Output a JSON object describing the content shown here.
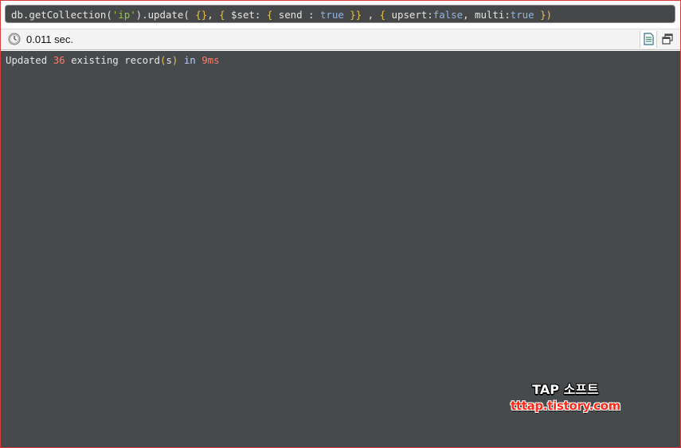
{
  "query": {
    "tokens": [
      {
        "text": "db.getCollection(",
        "type": "plain"
      },
      {
        "text": "'ip'",
        "type": "str"
      },
      {
        "text": ").update( ",
        "type": "plain"
      },
      {
        "text": "{}",
        "type": "brace"
      },
      {
        "text": ", ",
        "type": "plain"
      },
      {
        "text": "{",
        "type": "brace"
      },
      {
        "text": " $set: ",
        "type": "key"
      },
      {
        "text": "{",
        "type": "brace"
      },
      {
        "text": " send : ",
        "type": "key"
      },
      {
        "text": "true",
        "type": "bool"
      },
      {
        "text": " ",
        "type": "plain"
      },
      {
        "text": "}}",
        "type": "brace"
      },
      {
        "text": " , ",
        "type": "plain"
      },
      {
        "text": "{",
        "type": "brace"
      },
      {
        "text": " upsert:",
        "type": "key"
      },
      {
        "text": "false",
        "type": "bool"
      },
      {
        "text": ", multi:",
        "type": "key"
      },
      {
        "text": "true",
        "type": "bool"
      },
      {
        "text": " ",
        "type": "plain"
      },
      {
        "text": "})",
        "type": "brace"
      }
    ]
  },
  "status": {
    "elapsed": "0.011 sec.",
    "icons": {
      "clock": "clock-icon",
      "text_view": "document-icon",
      "popout": "popout-icon"
    }
  },
  "result": {
    "prefix": "Updated ",
    "count": "36",
    "middle": " existing record",
    "paren_open": "(",
    "suffix_letter": "s",
    "paren_close": ")",
    "in_word": " in ",
    "time": "9ms"
  },
  "watermark": {
    "title": "TAP 소프트",
    "url": "tttap.tistory.com"
  },
  "colors": {
    "query_bg": "#454748",
    "results_bg": "#474a4c",
    "number": "#ff7a6b",
    "string": "#96c93d",
    "boolean": "#8fb6e6",
    "brace": "#e8c34a"
  }
}
